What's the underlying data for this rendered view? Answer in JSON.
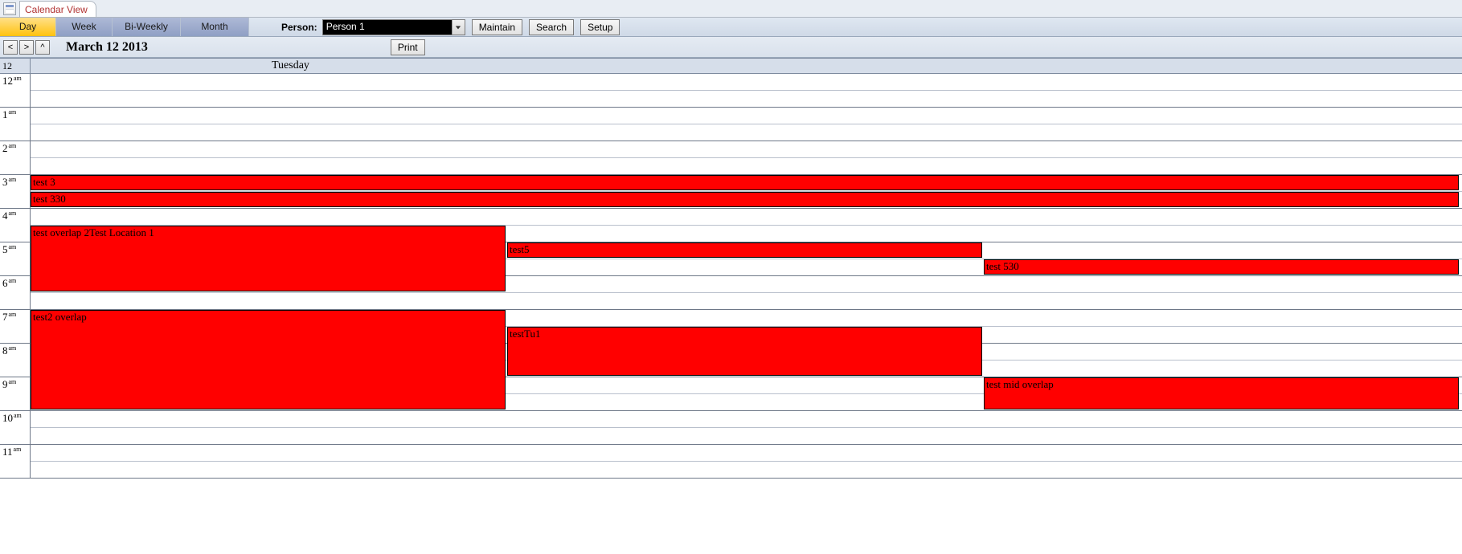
{
  "tab": {
    "title": "Calendar View"
  },
  "views": {
    "day": "Day",
    "week": "Week",
    "biweekly": "Bi-Weekly",
    "month": "Month",
    "active": "day"
  },
  "person": {
    "label": "Person:",
    "value": "Person 1"
  },
  "buttons": {
    "maintain": "Maintain",
    "search": "Search",
    "setup": "Setup",
    "print": "Print",
    "prev": "<",
    "next": ">",
    "up": "^"
  },
  "date": {
    "title": "March 12 2013",
    "dayNumber": "12",
    "dayName": "Tuesday"
  },
  "hours": [
    {
      "h": "12",
      "ap": "am"
    },
    {
      "h": "1",
      "ap": "am"
    },
    {
      "h": "2",
      "ap": "am"
    },
    {
      "h": "3",
      "ap": "am"
    },
    {
      "h": "4",
      "ap": "am"
    },
    {
      "h": "5",
      "ap": "am"
    },
    {
      "h": "6",
      "ap": "am"
    },
    {
      "h": "7",
      "ap": "am"
    },
    {
      "h": "8",
      "ap": "am"
    },
    {
      "h": "9",
      "ap": "am"
    },
    {
      "h": "10",
      "ap": "am"
    },
    {
      "h": "11",
      "ap": "am"
    }
  ],
  "layout": {
    "halfHourHeight": 21
  },
  "events": [
    {
      "id": "e1",
      "label": "test 3",
      "startHalf": 6,
      "durHalf": 1,
      "colStart": 0,
      "colSpan": 3,
      "totalCols": 3
    },
    {
      "id": "e2",
      "label": "test 330",
      "startHalf": 7,
      "durHalf": 1,
      "colStart": 0,
      "colSpan": 3,
      "totalCols": 3
    },
    {
      "id": "e3",
      "label": "test overlap 2Test Location 1",
      "startHalf": 9,
      "durHalf": 4,
      "colStart": 0,
      "colSpan": 1,
      "totalCols": 3
    },
    {
      "id": "e4",
      "label": "test5",
      "startHalf": 10,
      "durHalf": 1,
      "colStart": 1,
      "colSpan": 1,
      "totalCols": 3
    },
    {
      "id": "e5",
      "label": "test 530",
      "startHalf": 11,
      "durHalf": 1,
      "colStart": 2,
      "colSpan": 1,
      "totalCols": 3
    },
    {
      "id": "e6",
      "label": "test2 overlap",
      "startHalf": 14,
      "durHalf": 6,
      "colStart": 0,
      "colSpan": 1,
      "totalCols": 3
    },
    {
      "id": "e7",
      "label": "testTu1",
      "startHalf": 15,
      "durHalf": 3,
      "colStart": 1,
      "colSpan": 1,
      "totalCols": 3
    },
    {
      "id": "e8",
      "label": "test mid overlap",
      "startHalf": 18,
      "durHalf": 2,
      "colStart": 2,
      "colSpan": 1,
      "totalCols": 3
    }
  ]
}
